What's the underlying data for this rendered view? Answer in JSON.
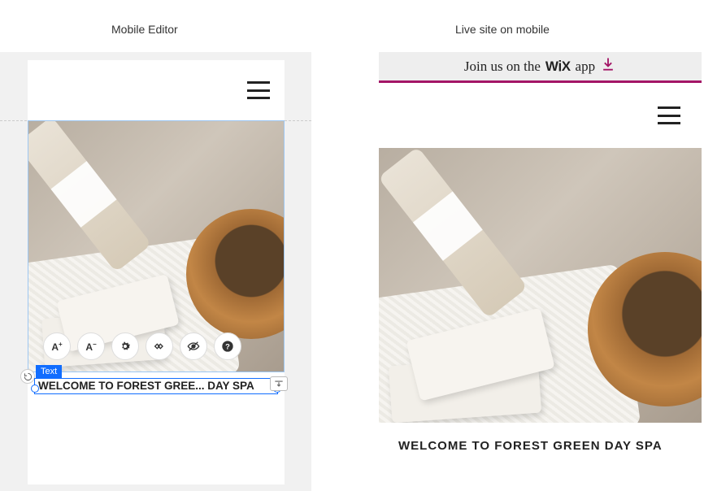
{
  "labels": {
    "left": "Mobile Editor",
    "right": "Live site on mobile"
  },
  "editor": {
    "selection_tag": "Text",
    "heading_text": "WELCOME TO FOREST GREE... DAY SPA",
    "toolbar": {
      "font_inc": "A⁺",
      "font_dec": "A⁻"
    }
  },
  "live": {
    "banner_prefix": "Join us on the ",
    "banner_brand": "WiX",
    "banner_suffix": "app",
    "heading_text": "WELCOME TO FOREST GREEN DAY SPA"
  }
}
